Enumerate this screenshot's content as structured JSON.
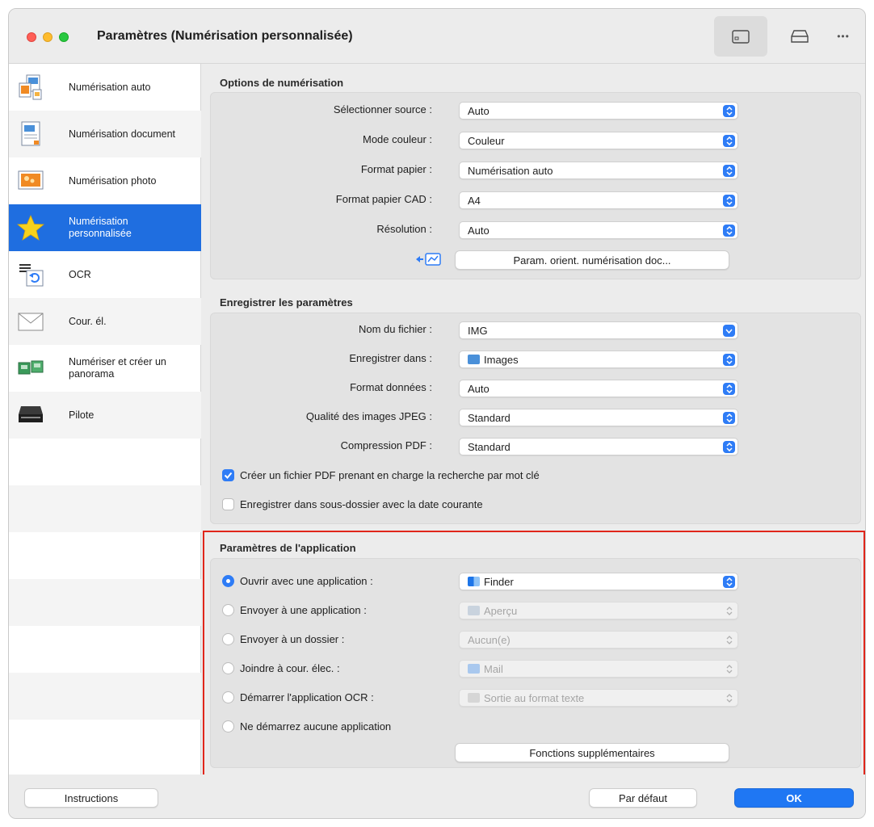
{
  "window": {
    "title": "Paramètres (Numérisation personnalisée)"
  },
  "toolbar": {
    "icons": [
      "sidebar-icon",
      "scanner-icon",
      "more-icon"
    ],
    "more_glyph": "•••"
  },
  "sidebar": {
    "items": [
      {
        "label": "Numérisation auto",
        "icon": "auto-scan-icon"
      },
      {
        "label": "Numérisation document",
        "icon": "document-scan-icon"
      },
      {
        "label": "Numérisation photo",
        "icon": "photo-scan-icon"
      },
      {
        "label": "Numérisation personnalisée",
        "icon": "star-icon",
        "selected": true
      },
      {
        "label": "OCR",
        "icon": "ocr-icon"
      },
      {
        "label": "Cour. él.",
        "icon": "envelope-icon"
      },
      {
        "label": "Numériser et créer un panorama",
        "icon": "panorama-icon"
      },
      {
        "label": "Pilote",
        "icon": "scanner-driver-icon"
      }
    ]
  },
  "scan_options": {
    "title": "Options de numérisation",
    "rows": [
      {
        "label": "Sélectionner source :",
        "value": "Auto"
      },
      {
        "label": "Mode couleur :",
        "value": "Couleur"
      },
      {
        "label": "Format papier :",
        "value": "Numérisation auto"
      },
      {
        "label": "Format papier CAD :",
        "value": "A4"
      },
      {
        "label": "Résolution :",
        "value": "Auto"
      }
    ],
    "orient_button": "Param. orient. numérisation doc..."
  },
  "save_settings": {
    "title": "Enregistrer les paramètres",
    "rows": [
      {
        "label": "Nom du fichier :",
        "value": "IMG"
      },
      {
        "label": "Enregistrer dans :",
        "value": "Images"
      },
      {
        "label": "Format données :",
        "value": "Auto"
      },
      {
        "label": "Qualité des images JPEG :",
        "value": "Standard"
      },
      {
        "label": "Compression PDF :",
        "value": "Standard"
      }
    ],
    "checkboxes": [
      {
        "label": "Créer un fichier PDF prenant en charge la recherche par mot clé",
        "checked": true
      },
      {
        "label": "Enregistrer dans sous-dossier avec la date courante",
        "checked": false
      }
    ]
  },
  "app_settings": {
    "title": "Paramètres de l'application",
    "options": [
      {
        "label": "Ouvrir avec une application :",
        "value": "Finder",
        "selected": true,
        "enabled": true
      },
      {
        "label": "Envoyer à une application :",
        "value": "Aperçu",
        "selected": false,
        "enabled": false
      },
      {
        "label": "Envoyer à un dossier :",
        "value": "Aucun(e)",
        "selected": false,
        "enabled": false
      },
      {
        "label": "Joindre à cour. élec. :",
        "value": "Mail",
        "selected": false,
        "enabled": false
      },
      {
        "label": "Démarrer l'application OCR :",
        "value": "Sortie au format texte",
        "selected": false,
        "enabled": false
      },
      {
        "label": "Ne démarrez aucune application",
        "selected": false
      }
    ],
    "more_button": "Fonctions supplémentaires"
  },
  "footer": {
    "instructions": "Instructions",
    "default": "Par défaut",
    "ok": "OK"
  },
  "colors": {
    "accent": "#1f6ee0",
    "highlight_border": "#e0261b"
  }
}
